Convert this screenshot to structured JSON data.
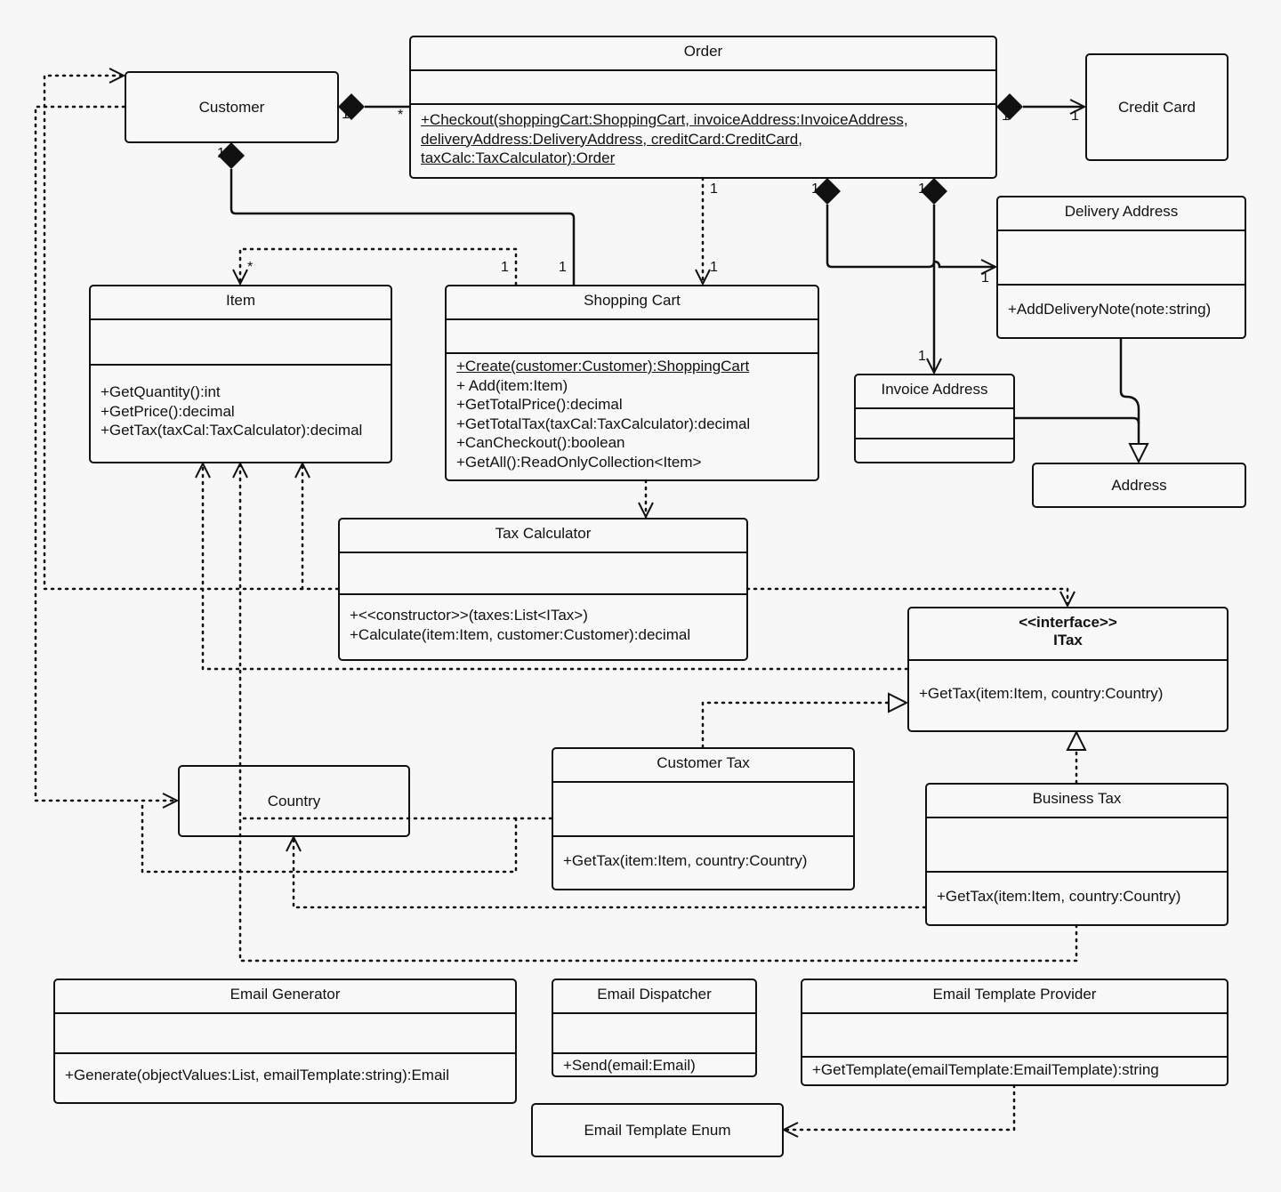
{
  "diagram": {
    "type": "UML class diagram",
    "classes": {
      "customer": {
        "name": "Customer"
      },
      "order": {
        "name": "Order",
        "operations": [
          "+Checkout(shoppingCart:ShoppingCart, invoiceAddress:InvoiceAddress,",
          "deliveryAddress:DeliveryAddress, creditCard:CreditCard,",
          "taxCalc:TaxCalculator):Order"
        ]
      },
      "credit_card": {
        "name": "Credit Card"
      },
      "delivery_address": {
        "name": "Delivery Address",
        "operations": [
          "+AddDeliveryNote(note:string)"
        ]
      },
      "item": {
        "name": "Item",
        "operations": [
          "+GetQuantity():int",
          "+GetPrice():decimal",
          "+GetTax(taxCal:TaxCalculator):decimal"
        ]
      },
      "shopping_cart": {
        "name": "Shopping Cart",
        "operations": [
          "+Create(customer:Customer):ShoppingCart",
          "+ Add(item:Item)",
          "+GetTotalPrice():decimal",
          "+GetTotalTax(taxCal:TaxCalculator):decimal",
          "+CanCheckout():boolean",
          "+GetAll():ReadOnlyCollection<Item>"
        ]
      },
      "invoice_address": {
        "name": "Invoice Address"
      },
      "address": {
        "name": "Address"
      },
      "tax_calculator": {
        "name": "Tax Calculator",
        "operations": [
          "+<<constructor>>(taxes:List<ITax>)",
          "+Calculate(item:Item, customer:Customer):decimal"
        ]
      },
      "itax": {
        "stereotype": "<<interface>>",
        "name": "ITax",
        "operations": [
          "+GetTax(item:Item, country:Country)"
        ]
      },
      "country": {
        "name": "Country"
      },
      "customer_tax": {
        "name": "Customer Tax",
        "operations": [
          "+GetTax(item:Item, country:Country)"
        ]
      },
      "business_tax": {
        "name": "Business Tax",
        "operations": [
          "+GetTax(item:Item, country:Country)"
        ]
      },
      "email_generator": {
        "name": "Email Generator",
        "operations": [
          "+Generate(objectValues:List, emailTemplate:string):Email"
        ]
      },
      "email_dispatcher": {
        "name": "Email Dispatcher",
        "operations": [
          "+Send(email:Email)"
        ]
      },
      "email_template_provider": {
        "name": "Email Template Provider",
        "operations": [
          "+GetTemplate(emailTemplate:EmailTemplate):string"
        ]
      },
      "email_template_enum": {
        "name": "Email Template Enum"
      }
    },
    "multiplicities": {
      "customer_order_customer_end": "1",
      "customer_order_order_end": "*",
      "order_creditcard_order_end": "1",
      "order_creditcard_card_end": "1",
      "order_cart_order_end": "1",
      "order_cart_cart_end": "1",
      "order_delivery_order_end": "1",
      "order_delivery_delivery_end": "1",
      "order_invoice_order_end": "1",
      "order_invoice_invoice_end": "1",
      "customer_cart_customer_end": "1",
      "customer_cart_cart_end": "1",
      "cart_item_cart_end": "1",
      "cart_item_item_end": "*"
    },
    "relationships": [
      {
        "from": "Order",
        "to": "Customer",
        "kind": "composition"
      },
      {
        "from": "Order",
        "to": "Credit Card",
        "kind": "composition"
      },
      {
        "from": "Order",
        "to": "Delivery Address",
        "kind": "composition"
      },
      {
        "from": "Order",
        "to": "Invoice Address",
        "kind": "composition"
      },
      {
        "from": "Order",
        "to": "Shopping Cart",
        "kind": "dependency"
      },
      {
        "from": "Customer",
        "to": "Shopping Cart",
        "kind": "composition"
      },
      {
        "from": "Shopping Cart",
        "to": "Item",
        "kind": "dependency"
      },
      {
        "from": "Shopping Cart",
        "to": "Tax Calculator",
        "kind": "dependency"
      },
      {
        "from": "Delivery Address",
        "to": "Address",
        "kind": "generalization"
      },
      {
        "from": "Invoice Address",
        "to": "Address",
        "kind": "generalization"
      },
      {
        "from": "Tax Calculator",
        "to": "ITax",
        "kind": "dependency"
      },
      {
        "from": "Tax Calculator",
        "to": "Item",
        "kind": "dependency"
      },
      {
        "from": "Tax Calculator",
        "to": "Customer",
        "kind": "dependency"
      },
      {
        "from": "ITax",
        "to": "Item",
        "kind": "dependency"
      },
      {
        "from": "ITax",
        "to": "Country",
        "kind": "dependency"
      },
      {
        "from": "Customer",
        "to": "Country",
        "kind": "dependency"
      },
      {
        "from": "Customer Tax",
        "to": "ITax",
        "kind": "realization"
      },
      {
        "from": "Business Tax",
        "to": "ITax",
        "kind": "realization"
      },
      {
        "from": "Customer Tax",
        "to": "Country",
        "kind": "dependency"
      },
      {
        "from": "Business Tax",
        "to": "Country",
        "kind": "dependency"
      },
      {
        "from": "Business Tax",
        "to": "Item",
        "kind": "dependency"
      },
      {
        "from": "Email Template Provider",
        "to": "Email Template Enum",
        "kind": "dependency"
      }
    ]
  }
}
